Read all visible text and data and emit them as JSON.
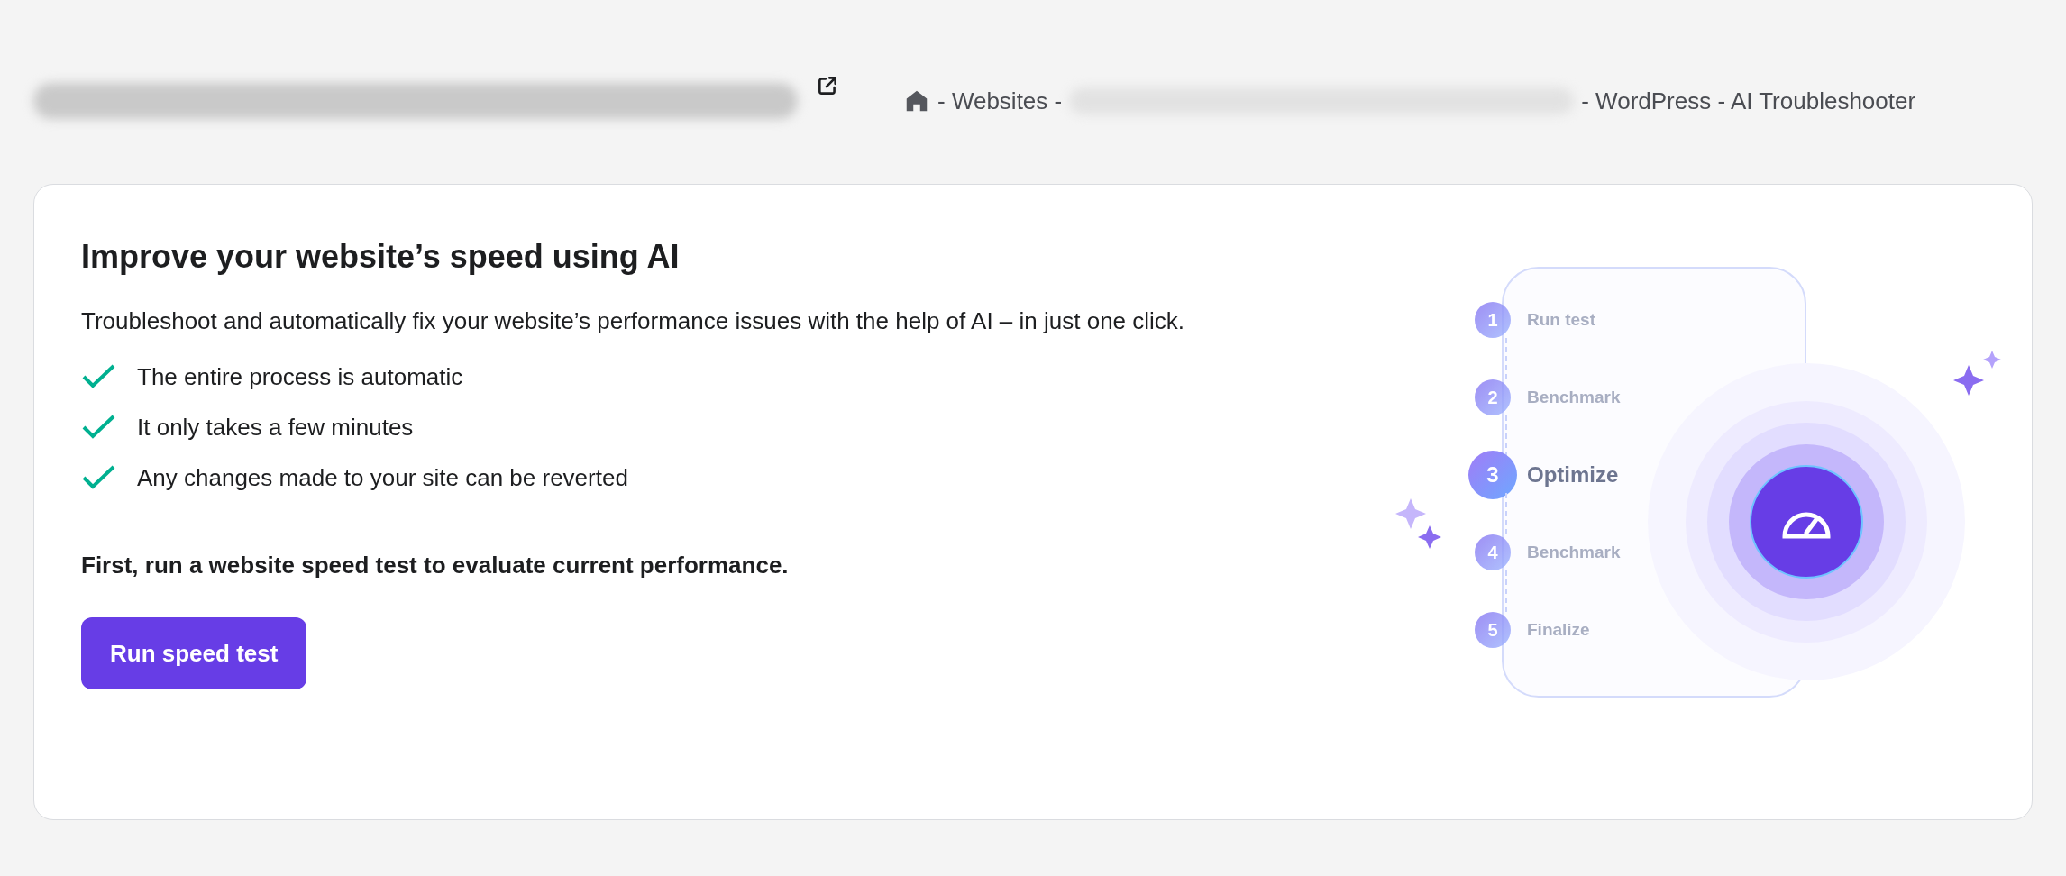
{
  "header": {
    "breadcrumb": [
      {
        "kind": "home"
      },
      {
        "kind": "text",
        "label": "- Websites -"
      },
      {
        "kind": "redacted"
      },
      {
        "kind": "text",
        "label": "- WordPress - AI Troubleshooter"
      }
    ]
  },
  "card": {
    "title": "Improve your website’s speed using AI",
    "description": "Troubleshoot and automatically fix your website’s performance issues with the help of AI – in just one click.",
    "features": [
      "The entire process is automatic",
      "It only takes a few minutes",
      "Any changes made to your site can be reverted"
    ],
    "note": "First, run a website speed test to evaluate current performance.",
    "button": "Run speed test",
    "steps": [
      {
        "number": "1",
        "label": "Run test",
        "active": false
      },
      {
        "number": "2",
        "label": "Benchmark",
        "active": false
      },
      {
        "number": "3",
        "label": "Optimize",
        "active": true
      },
      {
        "number": "4",
        "label": "Benchmark",
        "active": false
      },
      {
        "number": "5",
        "label": "Finalize",
        "active": false
      }
    ]
  }
}
